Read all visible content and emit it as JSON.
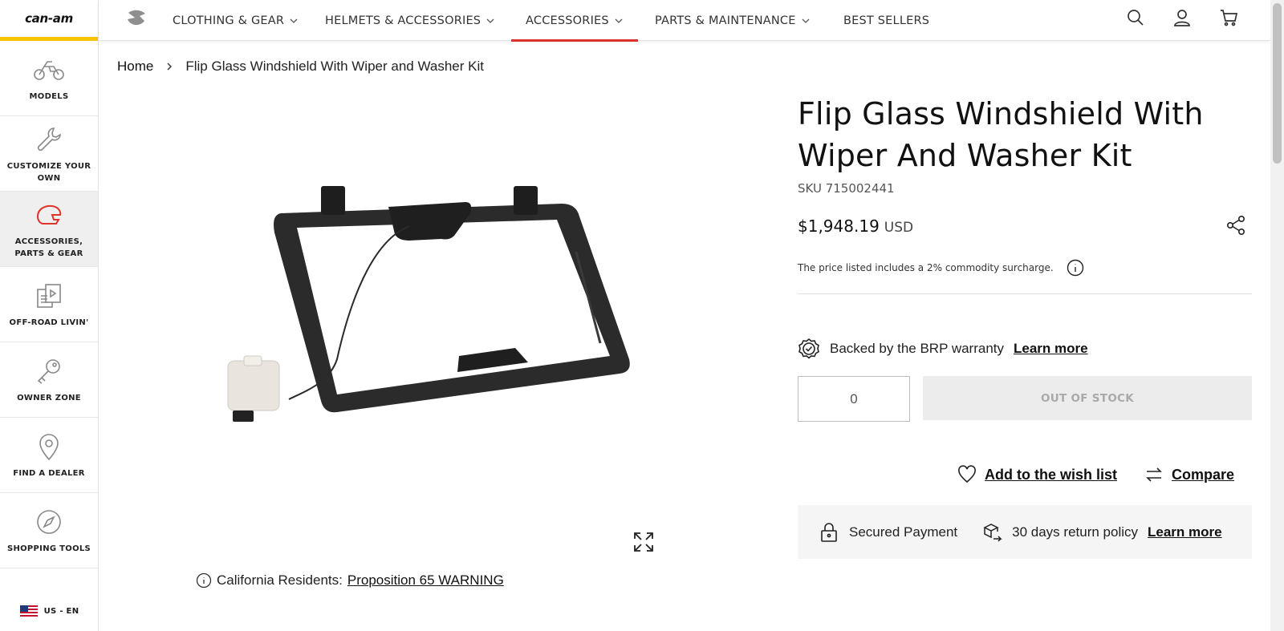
{
  "sidebar": {
    "logo": "can-am",
    "items": [
      {
        "label": "MODELS",
        "icon": "atv-icon"
      },
      {
        "label": "CUSTOMIZE YOUR OWN",
        "icon": "wrench-icon"
      },
      {
        "label": "ACCESSORIES, PARTS & GEAR",
        "icon": "helmet-icon"
      },
      {
        "label": "OFF-ROAD LIVIN'",
        "icon": "media-icon"
      },
      {
        "label": "OWNER ZONE",
        "icon": "key-icon"
      },
      {
        "label": "FIND A DEALER",
        "icon": "map-pin-icon"
      },
      {
        "label": "SHOPPING TOOLS",
        "icon": "compass-icon"
      }
    ],
    "locale": "US - EN"
  },
  "nav": {
    "items": [
      {
        "label": "CLOTHING & GEAR"
      },
      {
        "label": "HELMETS & ACCESSORIES"
      },
      {
        "label": "ACCESSORIES"
      },
      {
        "label": "PARTS & MAINTENANCE"
      },
      {
        "label": "BEST SELLERS"
      }
    ]
  },
  "breadcrumb": {
    "home": "Home",
    "current": "Flip Glass Windshield With Wiper and Washer Kit"
  },
  "product": {
    "title": "Flip Glass Windshield With Wiper And Washer Kit",
    "sku": "SKU 715002441",
    "price": "$1,948.19",
    "currency": "USD",
    "surcharge_note": "The price listed includes a 2% commodity surcharge.",
    "warranty_text": "Backed by the BRP warranty",
    "warranty_link": "Learn more",
    "quantity": "0",
    "stock_button": "OUT OF STOCK",
    "wishlist_label": "Add to the wish list",
    "compare_label": "Compare",
    "secured_payment": "Secured Payment",
    "return_policy": "30 days return policy",
    "return_link": "Learn more"
  },
  "prop65": {
    "prefix": "California Residents:",
    "link": "Proposition 65 WARNING"
  },
  "colors": {
    "accent_yellow": "#f6c400",
    "active_red": "#d9342b"
  }
}
